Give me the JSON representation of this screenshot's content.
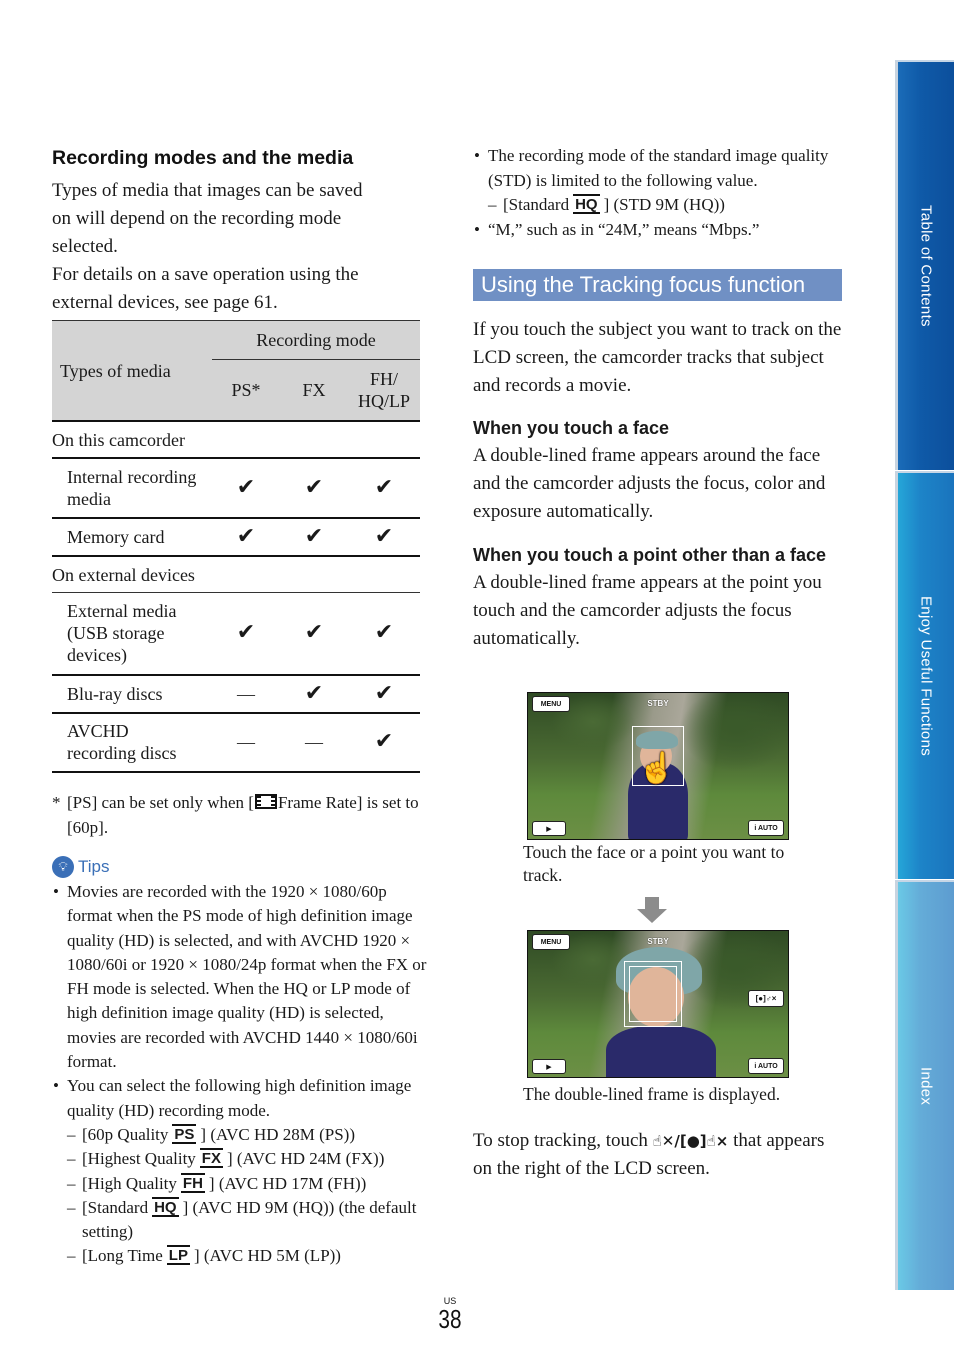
{
  "left": {
    "section_title": "Recording modes and the media",
    "intro_lines": [
      "Types of media that images can be saved",
      "on will depend on the recording mode",
      "selected.",
      "For details on a save operation using the",
      "external devices, see page 61."
    ],
    "table": {
      "header_media": "Types of media",
      "header_mode": "Recording mode",
      "header_cols": [
        "PS*",
        "FX",
        "FH/\nHQ/LP"
      ],
      "col_fh": [
        "FH/",
        "HQ/LP"
      ],
      "groups": [
        {
          "label": "On this camcorder",
          "rows": [
            {
              "name": [
                "Internal recording",
                "media"
              ],
              "values": [
                "✔",
                "✔",
                "✔"
              ]
            },
            {
              "name": [
                "Memory card"
              ],
              "values": [
                "✔",
                "✔",
                "✔"
              ]
            }
          ]
        },
        {
          "label": "On external devices",
          "rows": [
            {
              "name": [
                "External media",
                "(USB storage",
                "devices)"
              ],
              "values": [
                "✔",
                "✔",
                "✔"
              ]
            },
            {
              "name": [
                "Blu-ray discs"
              ],
              "values": [
                "—",
                "✔",
                "✔"
              ]
            },
            {
              "name": [
                "AVCHD",
                "recording discs"
              ],
              "values": [
                "—",
                "—",
                "✔"
              ]
            }
          ]
        }
      ]
    },
    "footnote": {
      "marker": "*",
      "pre": "[PS] can be set only when [",
      "post": "Frame Rate] is set to [60p]."
    },
    "tips": {
      "label": "Tips",
      "bullet1": "Movies are recorded with the 1920 × 1080/60p format when the PS mode of high definition image quality (HD) is selected, and with AVCHD 1920 × 1080/60i or 1920 × 1080/24p format when the FX or FH mode is selected. When the HQ or LP mode of high definition image quality (HD) is selected, movies are recorded with AVCHD 1440 × 1080/60i format.",
      "bullet2": "You can select the following high definition image quality (HD) recording mode.",
      "modes": [
        {
          "pre": "[60p Quality",
          "badge": "PS",
          "post": "] (AVC HD 28M (PS))"
        },
        {
          "pre": "[Highest Quality",
          "badge": "FX",
          "post": "] (AVC HD 24M (FX))"
        },
        {
          "pre": "[High Quality",
          "badge": "FH",
          "post": "] (AVC HD 17M (FH))"
        },
        {
          "pre": "[Standard",
          "badge": "HQ",
          "post": "] (AVC HD 9M (HQ)) (the default setting)"
        },
        {
          "pre": "[Long Time",
          "badge": "LP",
          "post": "] (AVC HD 5M (LP))"
        }
      ]
    }
  },
  "right": {
    "bullet_std": "The recording mode of the standard image quality (STD) is limited to the following value.",
    "std_mode": {
      "pre": "[Standard",
      "badge": "HQ",
      "post": "] (STD 9M (HQ))"
    },
    "bullet_m": "“M,” such as in “24M,” means “Mbps.”",
    "heading": "Using the Tracking focus function",
    "intro": "If you touch the subject you want to track on the LCD screen, the camcorder tracks that subject and records a movie.",
    "face_title": "When you touch a face",
    "face_text": "A double-lined frame appears around the face and the camcorder adjusts the focus, color and exposure automatically.",
    "point_title": "When you touch a point other than a face",
    "point_text": "A double-lined frame appears at the point you touch and the camcorder adjusts the focus automatically.",
    "lcd": {
      "menu_label": "MENU",
      "status": "STBY",
      "play_icon": "▶",
      "auto_label": "i AUTO",
      "cancel_icon": "[●]♂×"
    },
    "caption1": "Touch the face or a point you want to track.",
    "caption2": "The double-lined frame is displayed.",
    "stop_pre": "To stop tracking, touch",
    "stop_icons": "☝✕/[●]☝×",
    "stop_post": "that appears on the right of the LCD screen."
  },
  "side_tabs": [
    "Table of Contents",
    "Enjoy Useful Functions",
    "Index"
  ],
  "page": {
    "region": "US",
    "number": "38"
  }
}
